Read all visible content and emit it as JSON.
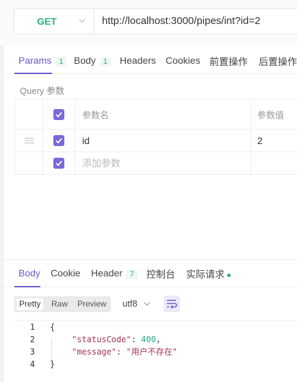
{
  "request": {
    "method": "GET",
    "url": "http://localhost:3000/pipes/int?id=2"
  },
  "request_tabs": [
    {
      "label": "Params",
      "badge": "1"
    },
    {
      "label": "Body",
      "badge": "1"
    },
    {
      "label": "Headers",
      "badge": ""
    },
    {
      "label": "Cookies",
      "badge": ""
    },
    {
      "label": "前置操作",
      "badge": ""
    },
    {
      "label": "后置操作",
      "badge": ""
    }
  ],
  "query_label": "Query 参数",
  "params_table": {
    "headers": [
      "参数名",
      "参数值"
    ],
    "rows": [
      {
        "name": "id",
        "value": "2",
        "checked": true
      }
    ],
    "add_placeholder": "添加参数"
  },
  "response_tabs": [
    {
      "label": "Body",
      "badge": ""
    },
    {
      "label": "Cookie",
      "badge": ""
    },
    {
      "label": "Header",
      "badge": "7"
    },
    {
      "label": "控制台",
      "badge": ""
    },
    {
      "label": "实际请求",
      "badge": ""
    }
  ],
  "format_options": [
    "Pretty",
    "Raw",
    "Preview"
  ],
  "selected_format": "Pretty",
  "encoding": "utf8",
  "response_body": {
    "lines": [
      {
        "n": "1",
        "text": "{"
      },
      {
        "n": "2",
        "key": "\"statusCode\"",
        "value": "400",
        "trail": ","
      },
      {
        "n": "3",
        "key": "\"message\"",
        "value": "\"用户不存在\"",
        "trail": ""
      },
      {
        "n": "4",
        "text": "}"
      }
    ]
  },
  "colors": {
    "accent": "#6a5acd",
    "method_get": "#27b07a",
    "checkbox": "#7b68d9"
  }
}
